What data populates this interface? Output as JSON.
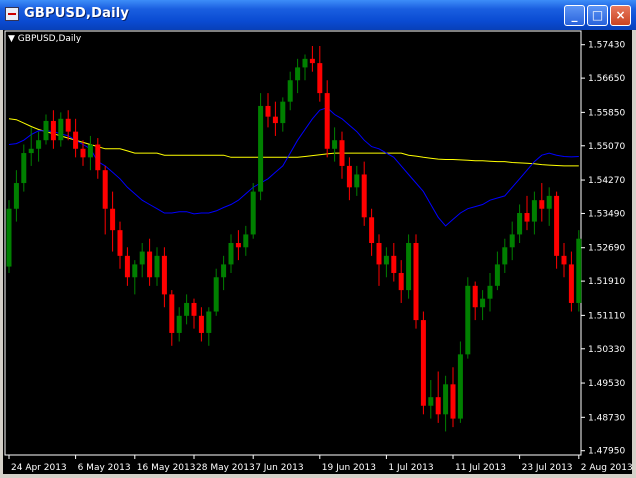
{
  "window": {
    "title": "GBPUSD,Daily",
    "minimize_label": "_",
    "maximize_label": "□",
    "close_label": "×"
  },
  "chart_header": {
    "symbol_label": "GBPUSD,Daily"
  },
  "colors": {
    "background": "#000000",
    "bull": "#008000",
    "bear": "#ff0000",
    "ma_fast": "#0000ff",
    "ma_slow": "#ffff00",
    "axis": "#ffffff"
  },
  "chart_data": {
    "type": "candlestick",
    "y_ticks": [
      "1.57430",
      "1.56650",
      "1.55850",
      "1.55070",
      "1.54270",
      "1.53490",
      "1.52690",
      "1.51910",
      "1.51110",
      "1.50330",
      "1.49530",
      "1.48730",
      "1.47950"
    ],
    "ylim": [
      1.4785,
      1.5775
    ],
    "x_ticks": [
      "24 Apr 2013",
      "6 May 2013",
      "16 May 2013",
      "28 May 2013",
      "7 Jun 2013",
      "19 Jun 2013",
      "1 Jul 2013",
      "11 Jul 2013",
      "23 Jul 2013",
      "2 Aug 2013"
    ],
    "candles": [
      [
        1.5225,
        1.538,
        1.521,
        1.536
      ],
      [
        1.536,
        1.545,
        1.533,
        1.542
      ],
      [
        1.542,
        1.551,
        1.54,
        1.549
      ],
      [
        1.549,
        1.555,
        1.546,
        1.55
      ],
      [
        1.55,
        1.554,
        1.547,
        1.552
      ],
      [
        1.552,
        1.558,
        1.551,
        1.5565
      ],
      [
        1.5565,
        1.559,
        1.55,
        1.552
      ],
      [
        1.552,
        1.5585,
        1.5505,
        1.557
      ],
      [
        1.557,
        1.559,
        1.552,
        1.554
      ],
      [
        1.554,
        1.557,
        1.548,
        1.55
      ],
      [
        1.55,
        1.552,
        1.546,
        1.548
      ],
      [
        1.548,
        1.553,
        1.545,
        1.551
      ],
      [
        1.551,
        1.5525,
        1.543,
        1.545
      ],
      [
        1.545,
        1.546,
        1.53,
        1.536
      ],
      [
        1.536,
        1.54,
        1.526,
        1.531
      ],
      [
        1.531,
        1.533,
        1.522,
        1.525
      ],
      [
        1.525,
        1.527,
        1.518,
        1.52
      ],
      [
        1.52,
        1.524,
        1.516,
        1.523
      ],
      [
        1.523,
        1.528,
        1.52,
        1.526
      ],
      [
        1.526,
        1.529,
        1.518,
        1.52
      ],
      [
        1.52,
        1.527,
        1.518,
        1.525
      ],
      [
        1.525,
        1.527,
        1.513,
        1.516
      ],
      [
        1.516,
        1.517,
        1.504,
        1.507
      ],
      [
        1.507,
        1.513,
        1.505,
        1.511
      ],
      [
        1.511,
        1.516,
        1.509,
        1.514
      ],
      [
        1.514,
        1.515,
        1.508,
        1.511
      ],
      [
        1.511,
        1.513,
        1.505,
        1.507
      ],
      [
        1.507,
        1.513,
        1.504,
        1.512
      ],
      [
        1.512,
        1.522,
        1.511,
        1.52
      ],
      [
        1.52,
        1.525,
        1.517,
        1.523
      ],
      [
        1.523,
        1.53,
        1.521,
        1.528
      ],
      [
        1.528,
        1.531,
        1.524,
        1.527
      ],
      [
        1.527,
        1.532,
        1.525,
        1.53
      ],
      [
        1.53,
        1.542,
        1.529,
        1.54
      ],
      [
        1.54,
        1.563,
        1.538,
        1.56
      ],
      [
        1.56,
        1.563,
        1.555,
        1.5575
      ],
      [
        1.5575,
        1.561,
        1.553,
        1.556
      ],
      [
        1.556,
        1.562,
        1.554,
        1.561
      ],
      [
        1.561,
        1.568,
        1.559,
        1.566
      ],
      [
        1.566,
        1.571,
        1.563,
        1.569
      ],
      [
        1.569,
        1.572,
        1.566,
        1.571
      ],
      [
        1.571,
        1.574,
        1.568,
        1.57
      ],
      [
        1.57,
        1.574,
        1.561,
        1.563
      ],
      [
        1.563,
        1.566,
        1.548,
        1.55
      ],
      [
        1.55,
        1.555,
        1.547,
        1.552
      ],
      [
        1.552,
        1.554,
        1.543,
        1.546
      ],
      [
        1.546,
        1.548,
        1.538,
        1.541
      ],
      [
        1.541,
        1.546,
        1.539,
        1.544
      ],
      [
        1.544,
        1.547,
        1.532,
        1.534
      ],
      [
        1.534,
        1.536,
        1.525,
        1.528
      ],
      [
        1.528,
        1.53,
        1.518,
        1.523
      ],
      [
        1.523,
        1.527,
        1.52,
        1.525
      ],
      [
        1.525,
        1.528,
        1.519,
        1.521
      ],
      [
        1.521,
        1.524,
        1.514,
        1.517
      ],
      [
        1.517,
        1.53,
        1.515,
        1.528
      ],
      [
        1.528,
        1.53,
        1.508,
        1.51
      ],
      [
        1.51,
        1.512,
        1.488,
        1.49
      ],
      [
        1.49,
        1.496,
        1.487,
        1.492
      ],
      [
        1.492,
        1.498,
        1.486,
        1.488
      ],
      [
        1.488,
        1.497,
        1.484,
        1.495
      ],
      [
        1.495,
        1.499,
        1.485,
        1.487
      ],
      [
        1.487,
        1.505,
        1.486,
        1.502
      ],
      [
        1.502,
        1.52,
        1.501,
        1.518
      ],
      [
        1.518,
        1.519,
        1.51,
        1.513
      ],
      [
        1.513,
        1.517,
        1.51,
        1.515
      ],
      [
        1.515,
        1.521,
        1.512,
        1.518
      ],
      [
        1.518,
        1.526,
        1.517,
        1.523
      ],
      [
        1.523,
        1.529,
        1.521,
        1.527
      ],
      [
        1.527,
        1.533,
        1.524,
        1.53
      ],
      [
        1.53,
        1.537,
        1.528,
        1.535
      ],
      [
        1.535,
        1.539,
        1.531,
        1.533
      ],
      [
        1.533,
        1.54,
        1.53,
        1.538
      ],
      [
        1.538,
        1.542,
        1.533,
        1.536
      ],
      [
        1.536,
        1.541,
        1.532,
        1.539
      ],
      [
        1.539,
        1.54,
        1.522,
        1.525
      ],
      [
        1.525,
        1.528,
        1.52,
        1.523
      ],
      [
        1.523,
        1.526,
        1.512,
        1.514
      ],
      [
        1.514,
        1.531,
        1.512,
        1.529
      ]
    ],
    "ma_fast": [
      1.551,
      1.5512,
      1.552,
      1.5533,
      1.5542,
      1.5542,
      1.554,
      1.5535,
      1.553,
      1.552,
      1.551,
      1.55,
      1.547,
      1.546,
      1.5445,
      1.543,
      1.541,
      1.5395,
      1.538,
      1.537,
      1.536,
      1.535,
      1.535,
      1.5353,
      1.5353,
      1.5348,
      1.535,
      1.535,
      1.5355,
      1.5363,
      1.537,
      1.538,
      1.5395,
      1.541,
      1.542,
      1.543,
      1.5445,
      1.546,
      1.549,
      1.552,
      1.5545,
      1.557,
      1.559,
      1.5596,
      1.558,
      1.557,
      1.5555,
      1.554,
      1.552,
      1.5505,
      1.55,
      1.549,
      1.548,
      1.546,
      1.544,
      1.542,
      1.54,
      1.537,
      1.534,
      1.532,
      1.5335,
      1.535,
      1.536,
      1.5365,
      1.537,
      1.538,
      1.5385,
      1.539,
      1.541,
      1.543,
      1.545,
      1.547,
      1.5485,
      1.549,
      1.5485,
      1.5482,
      1.5481,
      1.5482
    ],
    "ma_slow": [
      1.557,
      1.5568,
      1.556,
      1.5552,
      1.5545,
      1.554,
      1.5535,
      1.553,
      1.5525,
      1.552,
      1.5515,
      1.551,
      1.5505,
      1.55,
      1.55,
      1.55,
      1.5495,
      1.549,
      1.549,
      1.549,
      1.549,
      1.5485,
      1.5485,
      1.5485,
      1.5485,
      1.5485,
      1.5485,
      1.5485,
      1.5485,
      1.5485,
      1.548,
      1.548,
      1.548,
      1.548,
      1.548,
      1.548,
      1.548,
      1.548,
      1.548,
      1.548,
      1.5482,
      1.5484,
      1.5486,
      1.5488,
      1.549,
      1.549,
      1.549,
      1.549,
      1.549,
      1.549,
      1.549,
      1.549,
      1.549,
      1.549,
      1.5485,
      1.5483,
      1.548,
      1.5478,
      1.5476,
      1.5475,
      1.5475,
      1.5474,
      1.5473,
      1.5472,
      1.5472,
      1.5471,
      1.547,
      1.547,
      1.5468,
      1.5467,
      1.5466,
      1.5465,
      1.5463,
      1.5462,
      1.5461,
      1.546,
      1.546,
      1.546
    ]
  }
}
